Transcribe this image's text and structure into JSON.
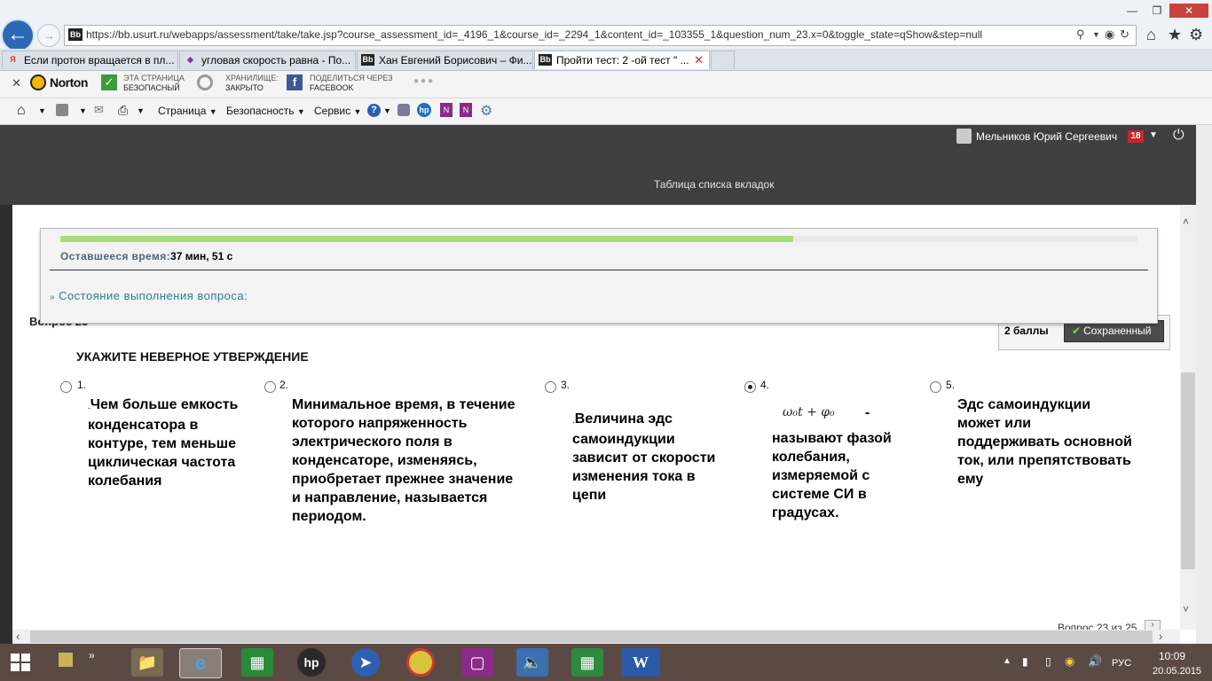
{
  "browser": {
    "url": "https://bb.usurt.ru/webapps/assessment/take/take.jsp?course_assessment_id=_4196_1&course_id=_2294_1&content_id=_103355_1&question_num_23.x=0&toggle_state=qShow&step=null",
    "site_icon": "Bb",
    "tabs": [
      {
        "label": "Если протон вращается в пл...",
        "icon": "Я"
      },
      {
        "label": "угловая скорость равна - По...",
        "icon": "◆"
      },
      {
        "label": "Хан Евгений Борисович – Фи...",
        "icon": "Bb"
      },
      {
        "label": "Пройти тест: 2 -ой тест \" ...",
        "icon": "Bb"
      }
    ],
    "tab_close": "✕"
  },
  "norton": {
    "close": "✕",
    "brand": "Norton",
    "safe_line1": "ЭТА СТРАНИЦА",
    "safe_line2": "БЕЗОПАСНЫЙ",
    "vault_line1": "ХРАНИЛИЩЕ:",
    "vault_line2": "ЗАКРЫТО",
    "share_line1": "ПОДЕЛИТЬСЯ ЧЕРЕЗ",
    "share_line2": "FACEBOOK",
    "more": "●●●"
  },
  "commandbar": {
    "page": "Страница",
    "security": "Безопасность",
    "service": "Сервис"
  },
  "header": {
    "user_name": "Мельников Юрий Сергеевич",
    "notifications": "18",
    "tab_list": "Таблица списка вкладок"
  },
  "timer": {
    "label": "Оставшееся время:",
    "value": "37 мин, 51 с",
    "progress_fraction": 0.68,
    "status_toggle": "Состояние выполнения вопроса:"
  },
  "question": {
    "label": "Вопрос 23",
    "points": "2 баллы",
    "saved": "Сохраненный",
    "title": "УКАЖИТЕ НЕВЕРНОЕ УТВЕРЖДЕНИЕ",
    "options": [
      {
        "num": "1.",
        "prefix": ".",
        "text": "Чем больше емкость конденсатора в контуре, тем меньше циклическая частота колебания",
        "selected": false
      },
      {
        "num": "2.",
        "prefix": "",
        "text": "Минимальное время, в течение которого напряженность электрического поля в конденсаторе,  изменяясь, приобретает   прежнее значение и направление, называется периодом.",
        "selected": false
      },
      {
        "num": "3.",
        "prefix": ".",
        "text": "Величина эдс самоиндукции зависит от скорости изменения тока в цепи",
        "selected": false
      },
      {
        "num": "4.",
        "prefix": "",
        "formula": "ω₀t  + φ₀",
        "dash": "-",
        "text": "называют фазой колебания, измеряемой с системе СИ в градусах.",
        "selected": true
      },
      {
        "num": "5.",
        "prefix": "",
        "text": "Эдс самоиндукции может или поддерживать основной ток, или препятствовать ему",
        "selected": false
      }
    ],
    "nav_text": "Вопрос 23 из 25"
  },
  "taskbar": {
    "lang": "РУС",
    "time": "10:09",
    "date": "20.05.2015"
  }
}
